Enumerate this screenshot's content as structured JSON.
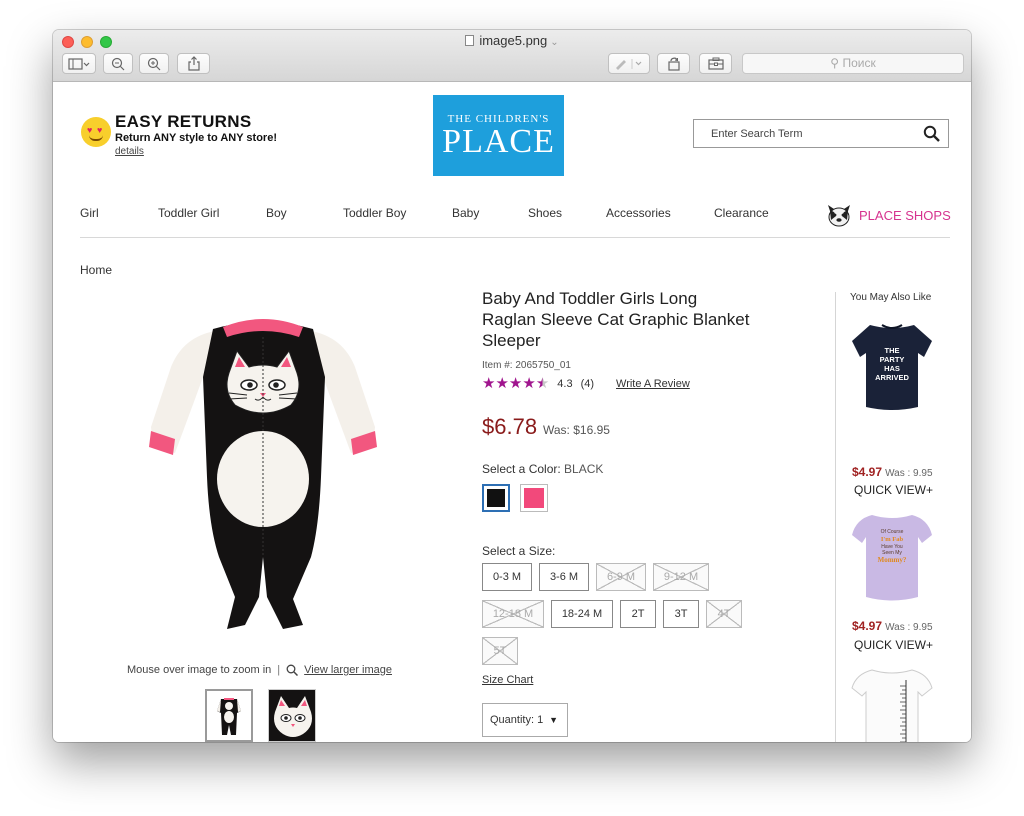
{
  "window": {
    "title": "image5.png",
    "search_placeholder": "Поиск"
  },
  "header": {
    "promo_title": "EASY RETURNS",
    "promo_subtitle": "Return ANY style to ANY store!",
    "promo_link": "details",
    "logo_line1": "THE CHILDREN'S",
    "logo_line2": "PLACE",
    "search_placeholder": "Enter Search Term"
  },
  "nav": {
    "items": [
      "Girl",
      "Toddler Girl",
      "Boy",
      "Toddler Boy",
      "Baby",
      "Shoes",
      "Accessories",
      "Clearance"
    ],
    "place_shops": "PLACE SHOPS"
  },
  "breadcrumb": "Home",
  "product": {
    "title": "Baby And Toddler Girls Long Raglan Sleeve Cat Graphic Blanket Sleeper",
    "item_number": "Item #: 2065750_01",
    "rating": 4.3,
    "rating_text": "4.3",
    "review_count": "(4)",
    "write_review": "Write A Review",
    "price": "$6.78",
    "was_price": "Was: $16.95",
    "color_label": "Select a Color:",
    "color_value": "BLACK",
    "colors": [
      "#111111",
      "#f2497b"
    ],
    "size_label": "Select a Size:",
    "sizes": [
      {
        "label": "0-3 M",
        "available": true
      },
      {
        "label": "3-6 M",
        "available": true
      },
      {
        "label": "6-9 M",
        "available": false
      },
      {
        "label": "9-12 M",
        "available": false
      },
      {
        "label": "12-18 M",
        "available": false
      },
      {
        "label": "18-24 M",
        "available": true
      },
      {
        "label": "2T",
        "available": true
      },
      {
        "label": "3T",
        "available": true
      },
      {
        "label": "4T",
        "available": false
      },
      {
        "label": "5T",
        "available": false
      }
    ],
    "size_chart": "Size Chart",
    "quantity": "Quantity: 1",
    "zoom_hint": "Mouse over image to zoom in",
    "zoom_separator": "|",
    "view_larger": "View larger image"
  },
  "recommendations": {
    "title": "You May Also Like",
    "items": [
      {
        "price": "$4.97",
        "was": "Was : 9.95",
        "quick_view": "QUICK VIEW+",
        "shirt_text": "THE PARTY HAS ARRIVED"
      },
      {
        "price": "$4.97",
        "was": "Was : 9.95",
        "quick_view": "QUICK VIEW+",
        "shirt_text": "Of Course I'm Fab Have You Seen My Mommy?"
      },
      {
        "price": "",
        "was": "",
        "quick_view": "",
        "shirt_text": ""
      }
    ]
  }
}
